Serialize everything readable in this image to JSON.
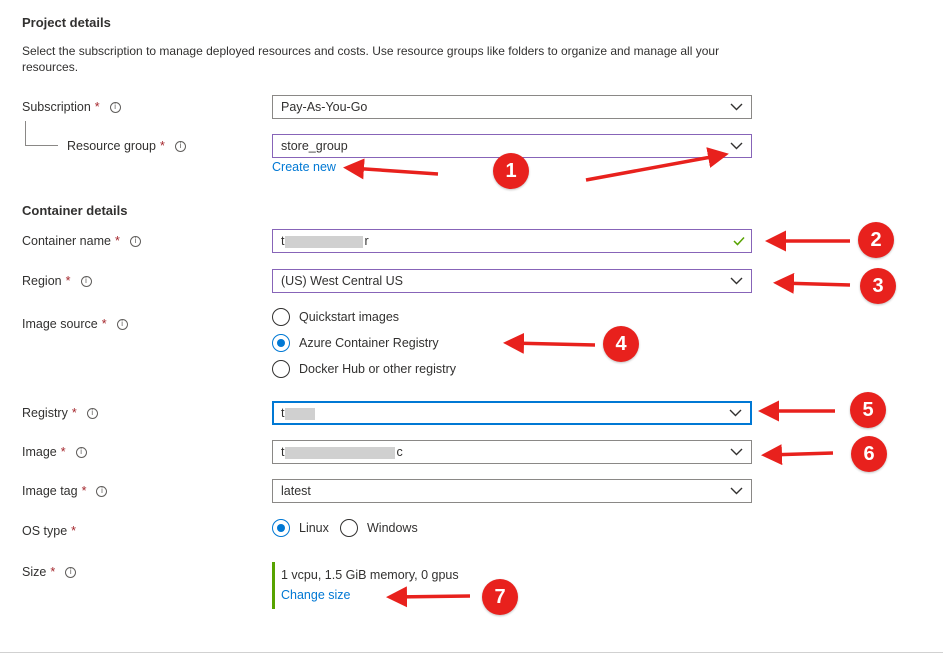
{
  "project": {
    "title": "Project details",
    "description": "Select the subscription to manage deployed resources and costs. Use resource groups like folders to organize and manage all your resources."
  },
  "subscription": {
    "label": "Subscription",
    "value": "Pay-As-You-Go"
  },
  "resource_group": {
    "label": "Resource group",
    "value": "store_group",
    "create_new": "Create new"
  },
  "container": {
    "title": "Container details"
  },
  "container_name": {
    "label": "Container name",
    "value_start": "t",
    "value_end": "r"
  },
  "region": {
    "label": "Region",
    "value": "(US) West Central US"
  },
  "image_source": {
    "label": "Image source",
    "options": [
      "Quickstart images",
      "Azure Container Registry",
      "Docker Hub or other registry"
    ],
    "selected": "Azure Container Registry"
  },
  "registry": {
    "label": "Registry",
    "value_start": "t"
  },
  "image": {
    "label": "Image",
    "value_start": "t",
    "value_end": "c"
  },
  "image_tag": {
    "label": "Image tag",
    "value": "latest"
  },
  "os_type": {
    "label": "OS type",
    "options": [
      "Linux",
      "Windows"
    ],
    "selected": "Linux"
  },
  "size": {
    "label": "Size",
    "value": "1 vcpu, 1.5 GiB memory, 0 gpus",
    "change": "Change size"
  },
  "required_marker": "*",
  "info_glyph": "i",
  "annotations": [
    "1",
    "2",
    "3",
    "4",
    "5",
    "6",
    "7"
  ],
  "colors": {
    "accent": "#0078d4",
    "required": "#a4262c",
    "valid": "#57a300",
    "annotation": "#e8211d",
    "highlight_border": "#8764b8"
  }
}
